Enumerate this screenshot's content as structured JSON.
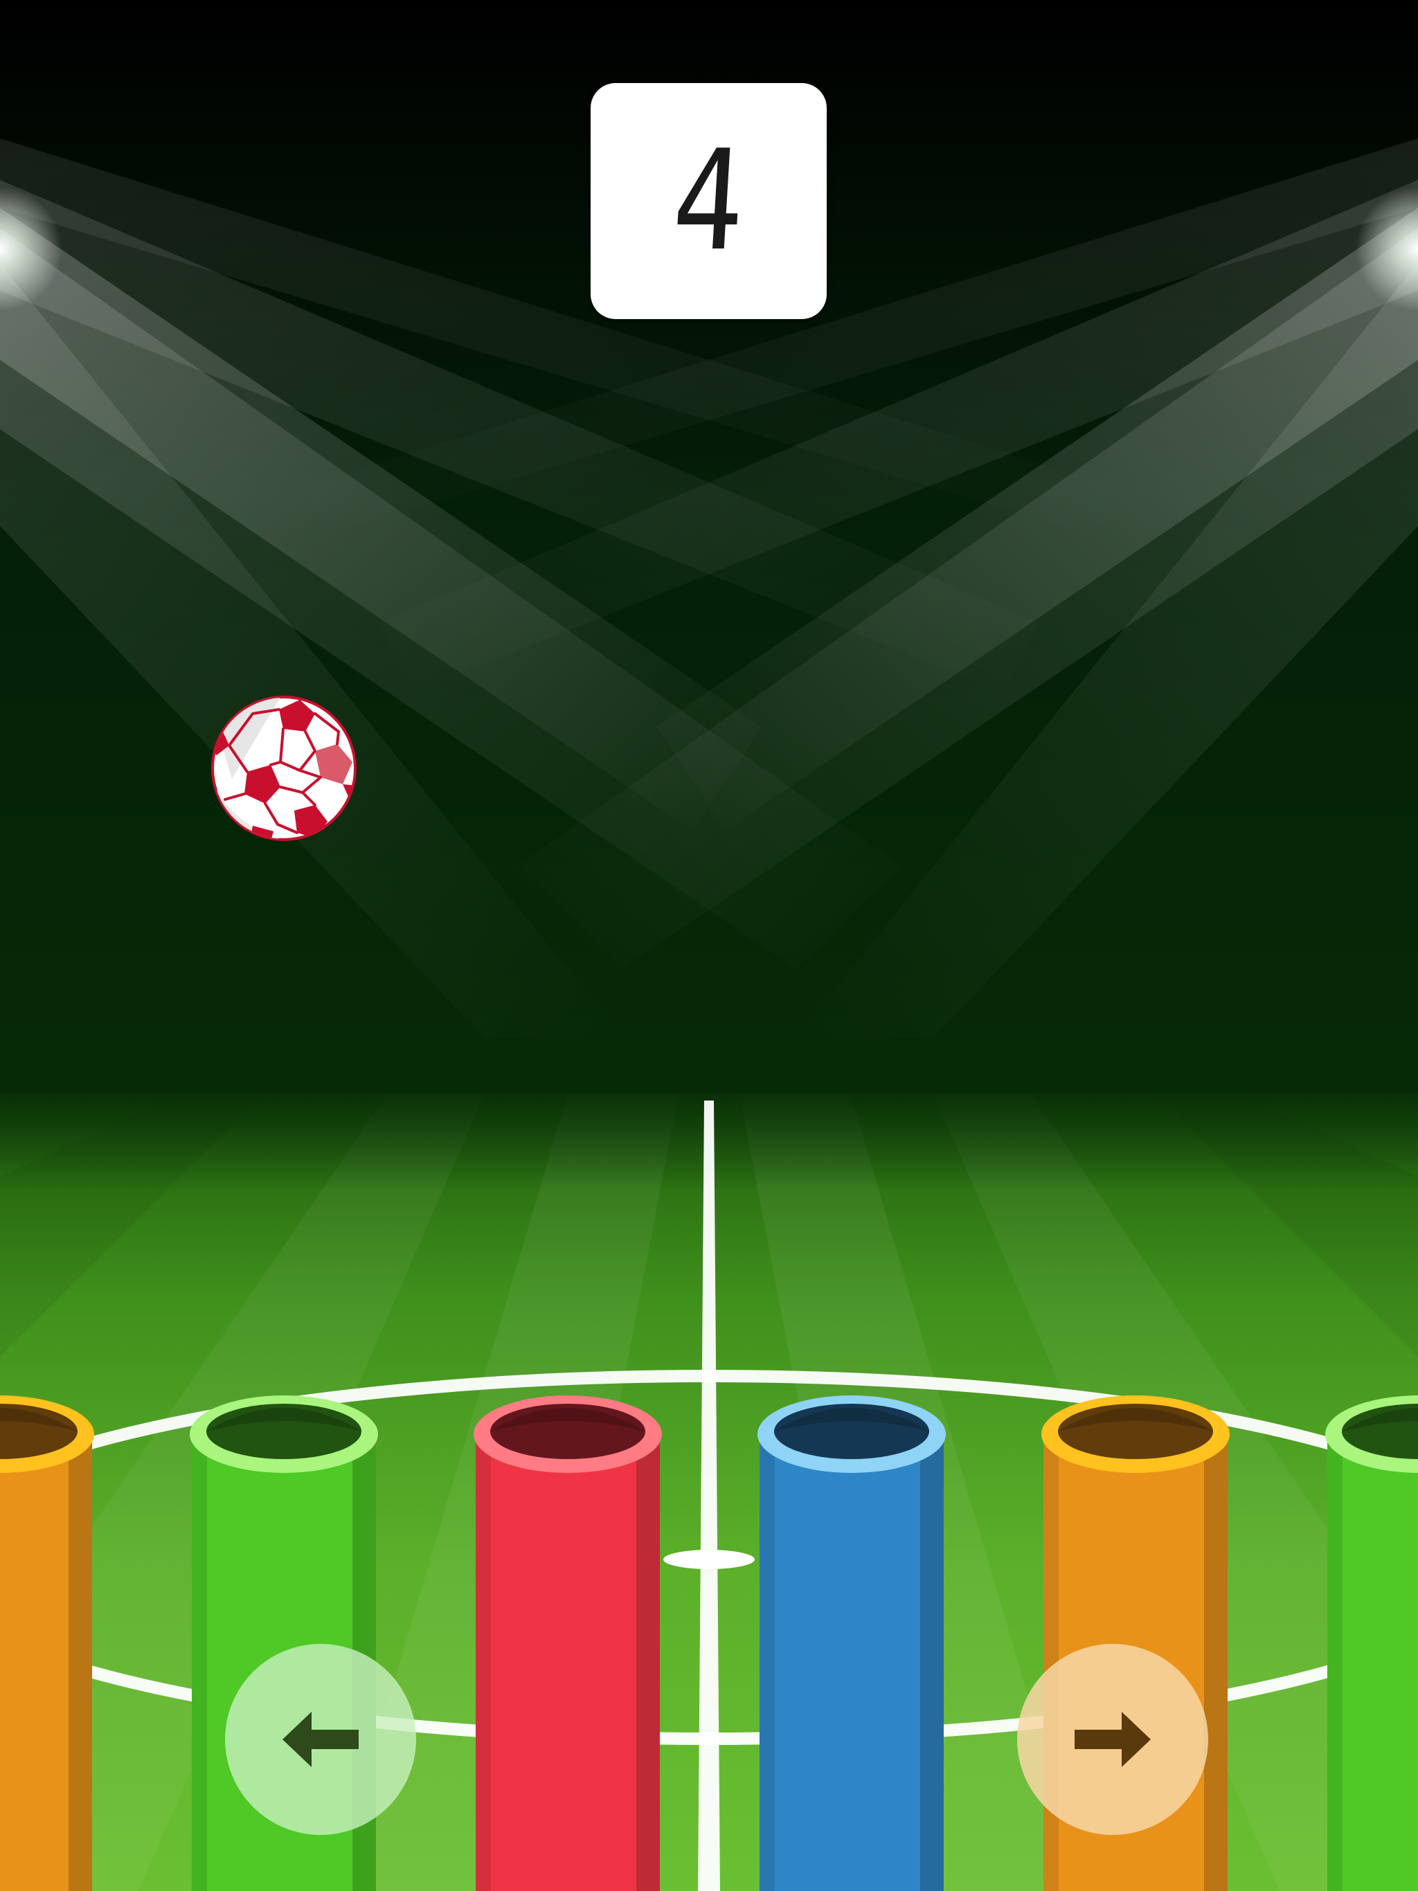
{
  "hud": {
    "score": "4"
  },
  "ball": {
    "icon": "soccer-ball-icon",
    "colors": {
      "primary": "#ffffff",
      "accent": "#c8102e"
    }
  },
  "tubes": [
    {
      "color": "orange",
      "body": "#e8921a",
      "rim": "#ffc21e"
    },
    {
      "color": "green",
      "body": "#4ec926",
      "rim": "#a9f57e"
    },
    {
      "color": "red",
      "body": "#ef3545",
      "rim": "#ff7c84"
    },
    {
      "color": "blue",
      "body": "#2f86c6",
      "rim": "#8fd4f6"
    },
    {
      "color": "orange",
      "body": "#e8921a",
      "rim": "#ffc21e"
    },
    {
      "color": "green",
      "body": "#4ec926",
      "rim": "#a9f57e"
    }
  ],
  "controls": {
    "left": {
      "icon": "arrow-left-icon",
      "color": "#2f4a1a"
    },
    "right": {
      "icon": "arrow-right-icon",
      "color": "#5a3a0c"
    }
  },
  "colors": {
    "sky_top": "#000000",
    "sky_bottom": "#062a06",
    "pitch_light": "#72c03a",
    "pitch_dark": "#2f7a12",
    "pitch_lines": "#ffffff"
  }
}
